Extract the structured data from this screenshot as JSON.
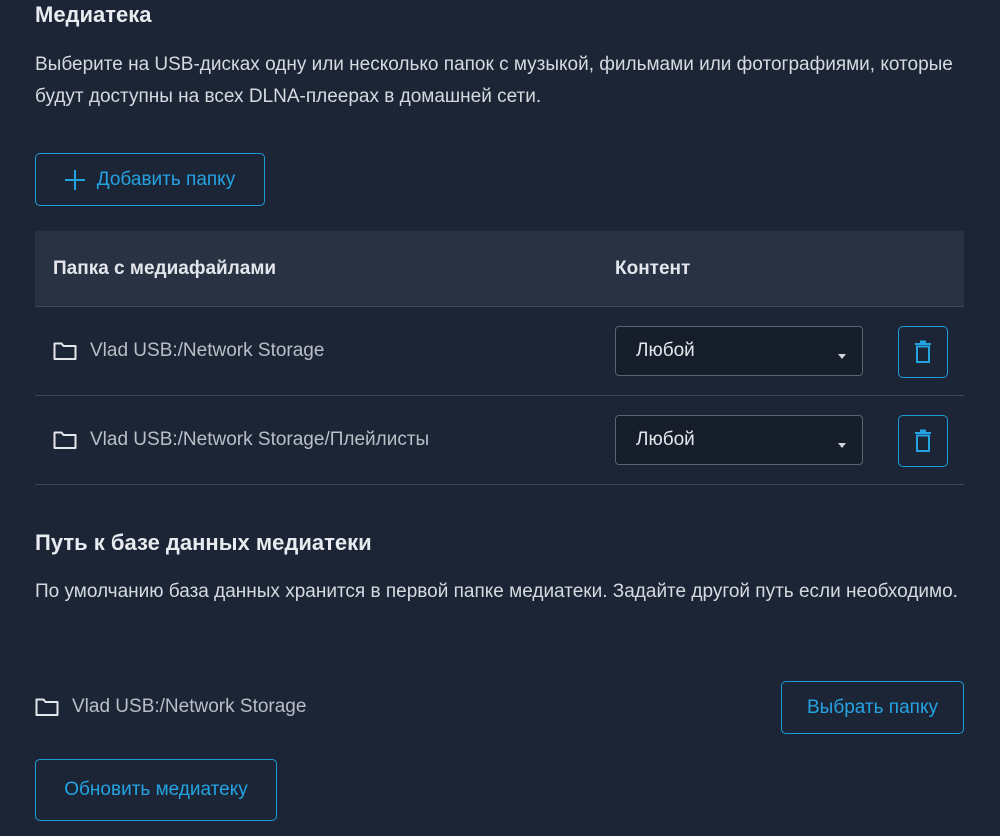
{
  "media_library": {
    "title": "Медиатека",
    "description": "Выберите на USB-дисках одну или несколько папок с музыкой, фильмами или фотографиями, которые будут доступны на всех DLNA-плеерах в домашней сети.",
    "add_folder_label": "Добавить папку"
  },
  "table": {
    "headers": {
      "folder": "Папка с медиафайлами",
      "content": "Контент"
    },
    "rows": [
      {
        "path": "Vlad USB:/Network Storage",
        "content": "Любой"
      },
      {
        "path": "Vlad USB:/Network Storage/Плейлисты",
        "content": "Любой"
      }
    ]
  },
  "database": {
    "title": "Путь к базе данных медиатеки",
    "description": "По умолчанию база данных хранится в первой папке медиатеки. Задайте другой путь если необходимо.",
    "path": "Vlad USB:/Network Storage",
    "select_folder_label": "Выбрать папку"
  },
  "update_button_label": "Обновить медиатеку",
  "icons": {
    "folder": "folder-icon",
    "trash": "trash-icon",
    "plus": "plus-icon",
    "caret": "caret-down-icon"
  },
  "colors": {
    "background": "#1c2535",
    "accent": "#24a3e3",
    "table_header": "#283243"
  }
}
